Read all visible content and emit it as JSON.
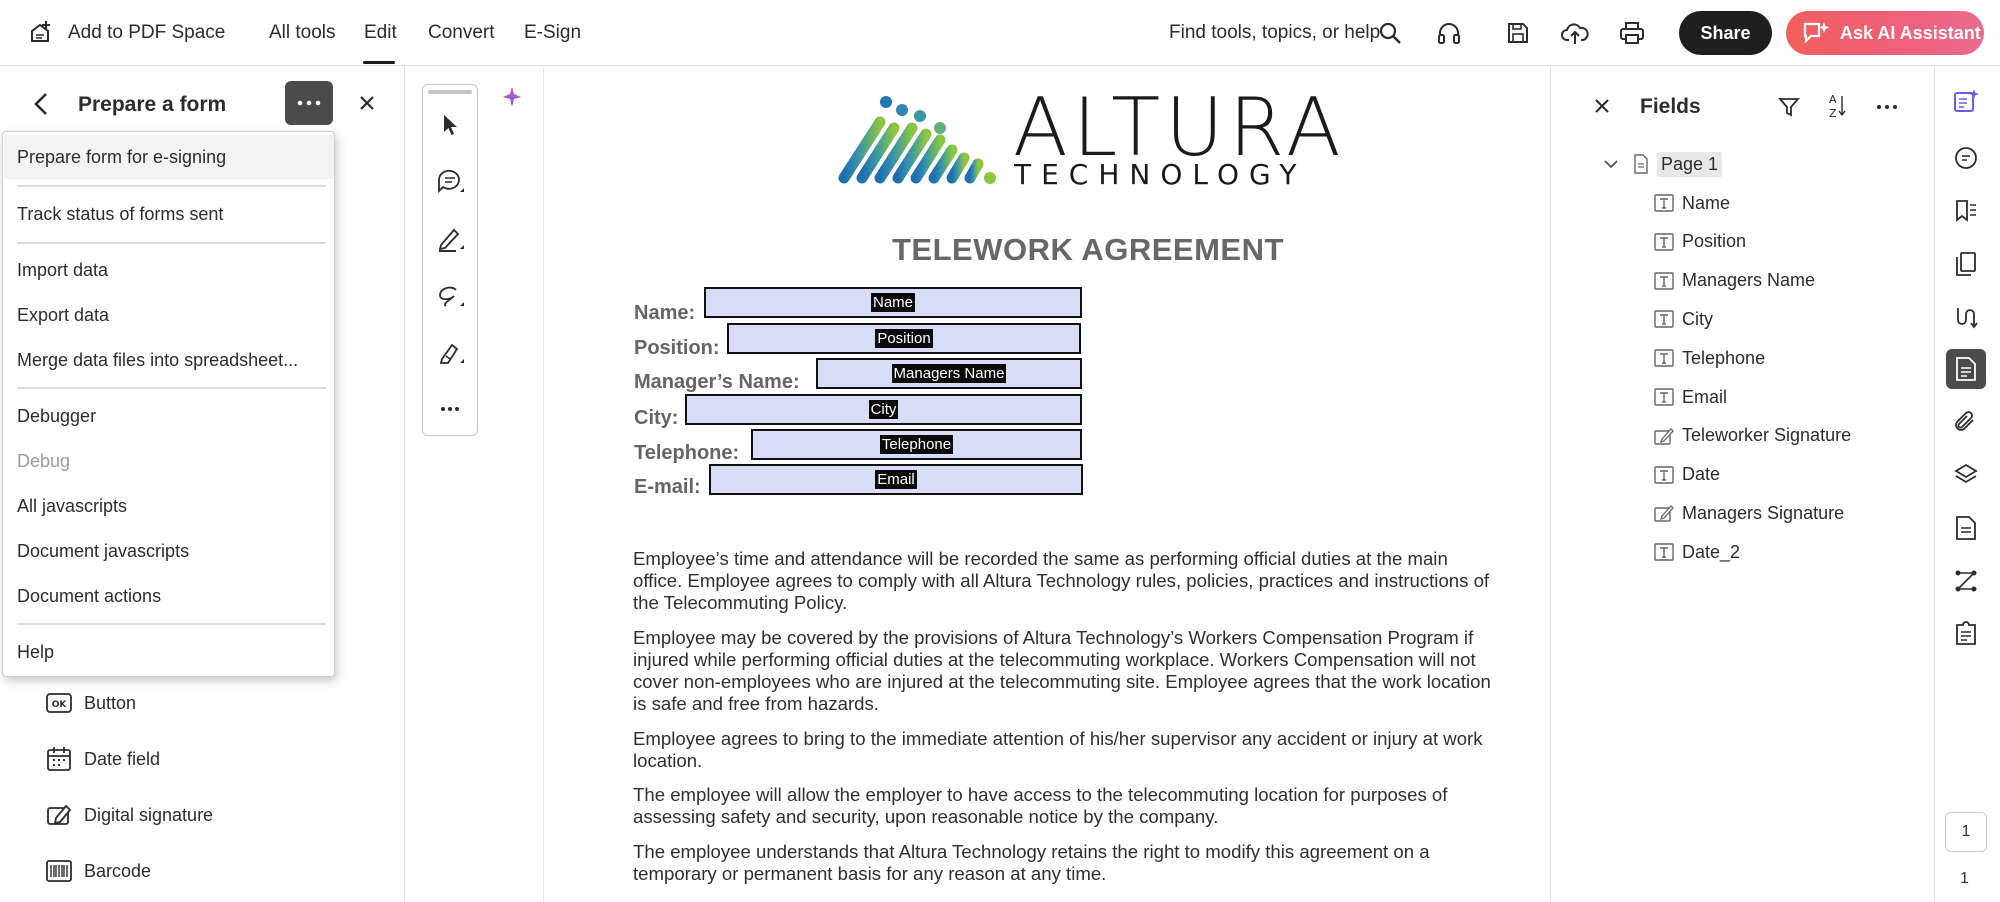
{
  "topbar": {
    "add_to_space": "Add to PDF Space",
    "menu": [
      "All tools",
      "Edit",
      "Convert",
      "E-Sign"
    ],
    "search_label": "Find tools, topics, or help",
    "share_label": "Share",
    "ai_label": "Ask AI Assistant"
  },
  "left_panel": {
    "title": "Prepare a form",
    "tools": [
      "Button",
      "Date field",
      "Digital signature",
      "Barcode"
    ]
  },
  "dropdown_menu": {
    "items": [
      "Prepare form for e-signing",
      "Track status of forms sent",
      "Import data",
      "Export data",
      "Merge data files into spreadsheet...",
      "Debugger",
      "Debug",
      "All javascripts",
      "Document javascripts",
      "Document actions",
      "Help"
    ]
  },
  "document": {
    "logo_main": "ALTURA",
    "logo_sub": "TECHNOLOGY",
    "title": "TELEWORK AGREEMENT",
    "form_labels": [
      "Name:",
      "Position:",
      "Manager’s Name:",
      "City:",
      "Telephone:",
      "E-mail:"
    ],
    "form_fields": [
      "Name",
      "Position",
      "Managers Name",
      "City",
      "Telephone",
      "Email"
    ],
    "paragraphs": [
      "Employee’s time and attendance will be recorded the same as performing official duties at the main office. Employee agrees to comply with all Altura Technology rules, policies, practices and instructions of the Telecommuting Policy.",
      "Employee may be covered by the provisions of Altura Technology’s Workers Compensation Program if injured while performing official duties at the telecommuting workplace. Workers Compensation will not cover non-employees who are injured at the telecommuting site. Employee agrees that the work location is safe and free from hazards.",
      "Employee agrees to bring to the immediate attention of his/her supervisor any accident or injury at work location.",
      "The employee will allow the employer to have access to the telecommuting location for purposes of assessing safety and security, upon reasonable notice by the company.",
      "The employee understands that Altura Technology retains the right to modify this agreement on a temporary or permanent basis for any reason at any time."
    ]
  },
  "fields_panel": {
    "title": "Fields",
    "page_label": "Page 1",
    "fields": [
      {
        "label": "Name",
        "type": "text-field-icon"
      },
      {
        "label": "Position",
        "type": "text-field-icon"
      },
      {
        "label": "Managers Name",
        "type": "text-field-icon"
      },
      {
        "label": "City",
        "type": "text-field-icon"
      },
      {
        "label": "Telephone",
        "type": "text-field-icon"
      },
      {
        "label": "Email",
        "type": "text-field-icon"
      },
      {
        "label": "Teleworker Signature",
        "type": "signature-field-icon"
      },
      {
        "label": "Date",
        "type": "text-field-icon"
      },
      {
        "label": "Managers Signature",
        "type": "signature-field-icon"
      },
      {
        "label": "Date_2",
        "type": "text-field-icon"
      }
    ]
  },
  "pager": {
    "current": "1",
    "total": "1"
  },
  "colors": {
    "accent": "#f2605e",
    "field_fill": "#d8dcf7",
    "active_rail": "#4b4b4b"
  }
}
